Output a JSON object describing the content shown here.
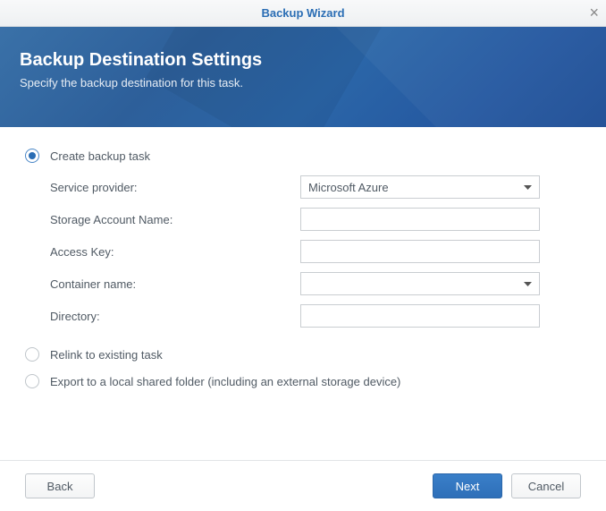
{
  "window": {
    "title": "Backup Wizard"
  },
  "banner": {
    "heading": "Backup Destination Settings",
    "subheading": "Specify the backup destination for this task."
  },
  "options": {
    "create": {
      "label": "Create backup task",
      "selected": true
    },
    "relink": {
      "label": "Relink to existing task",
      "selected": false
    },
    "export": {
      "label": "Export to a local shared folder (including an external storage device)",
      "selected": false
    }
  },
  "form": {
    "service_provider": {
      "label": "Service provider:",
      "value": "Microsoft Azure"
    },
    "storage_account": {
      "label": "Storage Account Name:",
      "value": ""
    },
    "access_key": {
      "label": "Access Key:",
      "value": ""
    },
    "container": {
      "label": "Container name:",
      "value": ""
    },
    "directory": {
      "label": "Directory:",
      "value": ""
    }
  },
  "buttons": {
    "back": "Back",
    "next": "Next",
    "cancel": "Cancel"
  }
}
